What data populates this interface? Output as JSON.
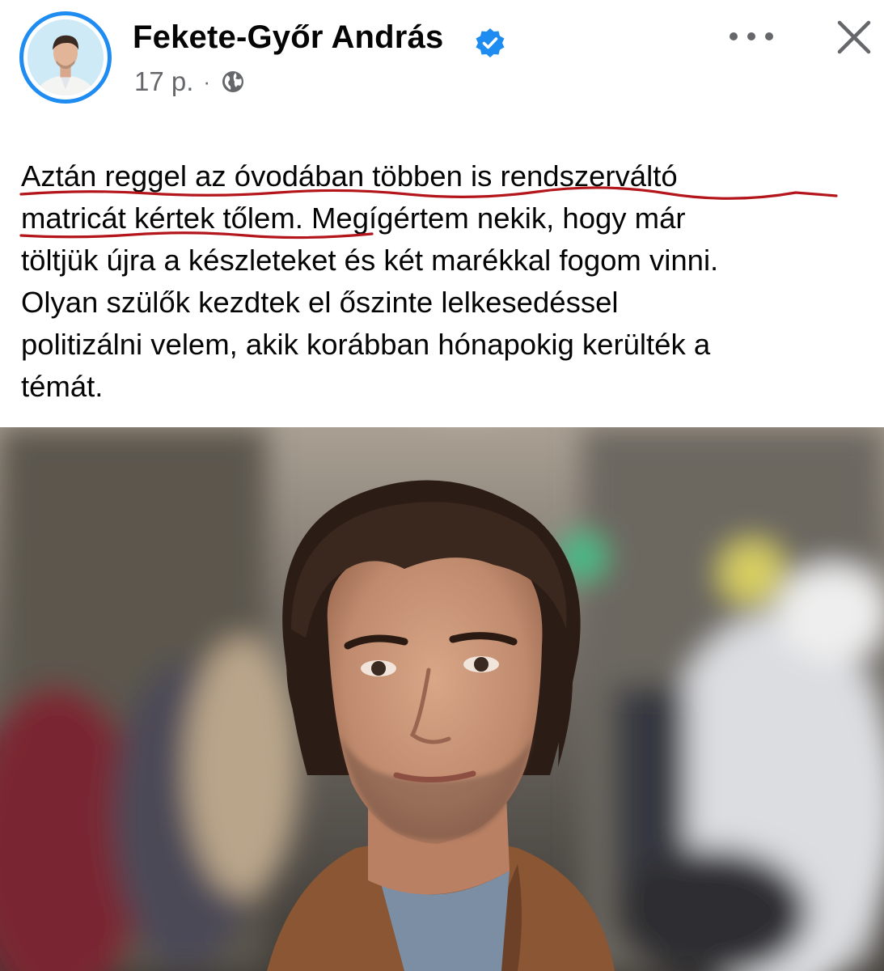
{
  "post": {
    "author_name": "Fekete-Győr András",
    "time": "17 p.",
    "separator": "·",
    "text_lines": [
      "Aztán reggel az óvodában többen is rendszerváltó",
      "matricát kértek tőlem",
      ". Megígértem nekik, hogy már",
      "töltjük újra a készleteket és két marékkal fogom vinni.",
      "Olyan szülők kezdtek el őszinte lelkesedéssel",
      "politizálni velem, akik korábban hónapokig kerülték a",
      "témát."
    ]
  },
  "icons": {
    "verified": "verified-badge-icon",
    "privacy": "globe-icon",
    "more": "more-options-icon",
    "close": "close-icon"
  },
  "colors": {
    "accent": "#1f8cf2",
    "text": "#050505",
    "secondary_text": "#65676b",
    "underline_annotation": "#b3151b"
  }
}
